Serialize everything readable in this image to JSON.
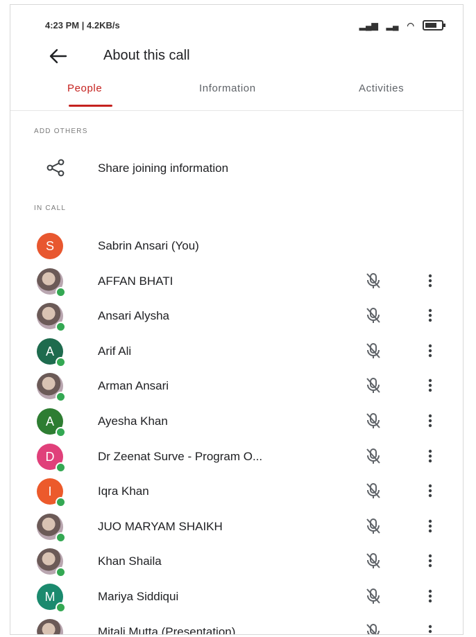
{
  "status_bar": {
    "time_and_speed": "4:23 PM | 4.2KB/s"
  },
  "header": {
    "title": "About this call"
  },
  "tabs": [
    {
      "label": "People",
      "active": true
    },
    {
      "label": "Information",
      "active": false
    },
    {
      "label": "Activities",
      "active": false
    }
  ],
  "add_others": {
    "section_label": "ADD OTHERS",
    "share_label": "Share joining information"
  },
  "in_call": {
    "section_label": "IN CALL",
    "participants": [
      {
        "name": "Sabrin Ansari (You)",
        "initial": "S",
        "avatar_color": "#e8572f",
        "photo": false,
        "online": false,
        "muted_icon": false
      },
      {
        "name": "AFFAN BHATI",
        "initial": "",
        "avatar_color": "",
        "photo": true,
        "online": true,
        "muted_icon": true
      },
      {
        "name": "Ansari Alysha",
        "initial": "",
        "avatar_color": "",
        "photo": true,
        "online": true,
        "muted_icon": true
      },
      {
        "name": "Arif Ali",
        "initial": "A",
        "avatar_color": "#1e6b4e",
        "photo": false,
        "online": true,
        "muted_icon": true
      },
      {
        "name": "Arman Ansari",
        "initial": "",
        "avatar_color": "",
        "photo": true,
        "online": true,
        "muted_icon": true
      },
      {
        "name": "Ayesha Khan",
        "initial": "A",
        "avatar_color": "#2e7d32",
        "photo": false,
        "online": true,
        "muted_icon": true
      },
      {
        "name": "Dr Zeenat Surve - Program O...",
        "initial": "D",
        "avatar_color": "#e0407a",
        "photo": false,
        "online": true,
        "muted_icon": true
      },
      {
        "name": "Iqra Khan",
        "initial": "I",
        "avatar_color": "#ec5a2b",
        "photo": false,
        "online": true,
        "muted_icon": true
      },
      {
        "name": "JUO MARYAM SHAIKH",
        "initial": "",
        "avatar_color": "",
        "photo": true,
        "online": true,
        "muted_icon": true
      },
      {
        "name": "Khan Shaila",
        "initial": "",
        "avatar_color": "",
        "photo": true,
        "online": true,
        "muted_icon": true
      },
      {
        "name": "Mariya Siddiqui",
        "initial": "M",
        "avatar_color": "#1b8a6e",
        "photo": false,
        "online": true,
        "muted_icon": true
      },
      {
        "name": "Mitali Mutta (Presentation)",
        "initial": "",
        "avatar_color": "",
        "photo": true,
        "online": false,
        "muted_icon": true
      }
    ]
  },
  "colors": {
    "accent": "#c5221f",
    "online": "#34a853"
  }
}
